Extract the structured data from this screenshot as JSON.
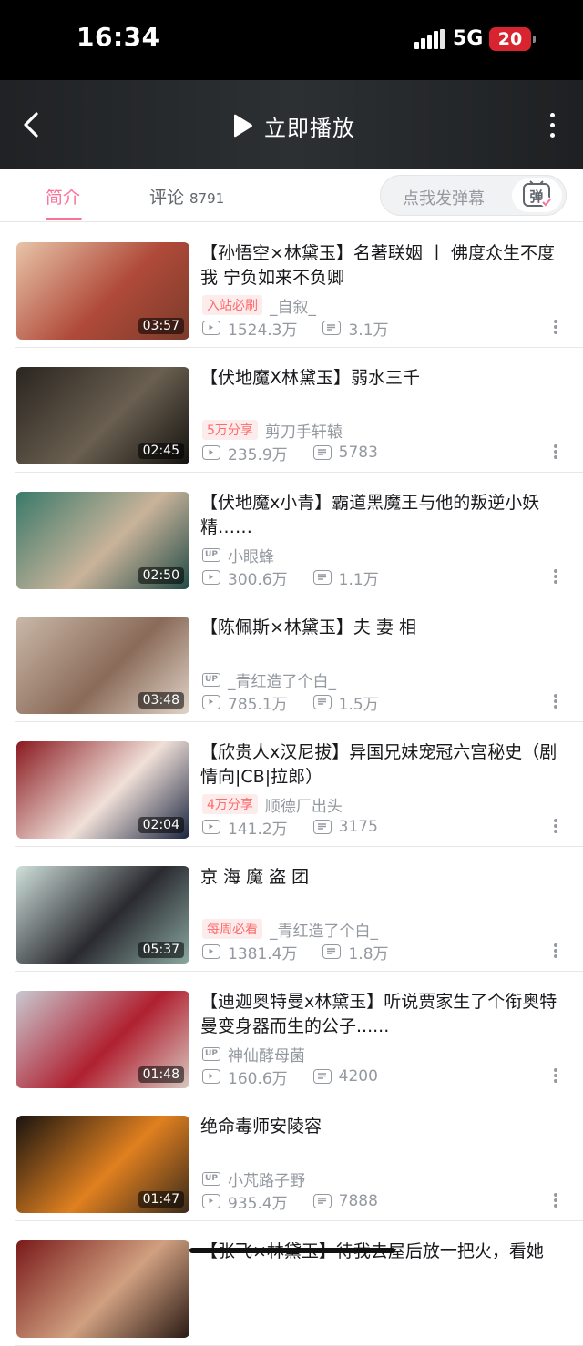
{
  "status_bar": {
    "time": "16:34",
    "network": "5G",
    "battery": "20"
  },
  "player_bar": {
    "play_label": "立即播放"
  },
  "tabs": {
    "intro": "简介",
    "comments": "评论",
    "comments_count": "8791",
    "danmaku_placeholder": "点我发弹幕"
  },
  "videos": [
    {
      "title": "【孙悟空×林黛玉】名著联姻 丨 佛度众生不度我  宁负如来不负卿",
      "badge": "入站必刷",
      "author": "_自叙_",
      "up_tag": false,
      "views": "1524.3万",
      "danmaku": "3.1万",
      "duration": "03:57",
      "thumb_colors": [
        "#e8c4a8",
        "#b04a3a",
        "#7a3b2a"
      ]
    },
    {
      "title": "【伏地魔X林黛玉】弱水三千",
      "badge": "5万分享",
      "author": "剪刀手轩辕",
      "up_tag": false,
      "views": "235.9万",
      "danmaku": "5783",
      "duration": "02:45",
      "thumb_colors": [
        "#2a2520",
        "#6a5f50",
        "#14120f"
      ]
    },
    {
      "title": "【伏地魔x小青】霸道黑魔王与他的叛逆小妖精……",
      "badge": "",
      "author": "小眼蜂",
      "up_tag": true,
      "views": "300.6万",
      "danmaku": "1.1万",
      "duration": "02:50",
      "thumb_colors": [
        "#3a7a6a",
        "#c9b39a",
        "#1f4a45"
      ]
    },
    {
      "title": "【陈佩斯×林黛玉】夫    妻    相",
      "badge": "",
      "author": "_青红造了个白_",
      "up_tag": true,
      "views": "785.1万",
      "danmaku": "1.5万",
      "duration": "03:48",
      "thumb_colors": [
        "#c9b8a8",
        "#8a6a58",
        "#e0d4c8"
      ]
    },
    {
      "title": "【欣贵人x汉尼拔】异国兄妹宠冠六宫秘史（剧情向|CB|拉郎）",
      "badge": "4万分享",
      "author": "顺德厂出头",
      "up_tag": false,
      "views": "141.2万",
      "danmaku": "3175",
      "duration": "02:04",
      "thumb_colors": [
        "#8a1a20",
        "#f0e0d8",
        "#1a2540"
      ]
    },
    {
      "title": "京 海 魔 盗 团",
      "badge": "每周必看",
      "author": "_青红造了个白_",
      "up_tag": false,
      "views": "1381.4万",
      "danmaku": "1.8万",
      "duration": "05:37",
      "thumb_colors": [
        "#cfe0da",
        "#2a2a30",
        "#8aa8a0"
      ]
    },
    {
      "title": "【迪迦奥特曼x林黛玉】听说贾家生了个衔奥特曼变身器而生的公子......",
      "badge": "",
      "author": "神仙酵母菌",
      "up_tag": true,
      "views": "160.6万",
      "danmaku": "4200",
      "duration": "01:48",
      "thumb_colors": [
        "#c8c8d0",
        "#b02030",
        "#d8c8c0"
      ]
    },
    {
      "title": "绝命毒师安陵容",
      "badge": "",
      "author": "小芃路子野",
      "up_tag": true,
      "views": "935.4万",
      "danmaku": "7888",
      "duration": "01:47",
      "thumb_colors": [
        "#1a1410",
        "#e08020",
        "#3a2a1a"
      ]
    },
    {
      "title": "【张飞×林黛玉】待我去屋后放一把火，看她",
      "badge": "",
      "author": "",
      "up_tag": false,
      "views": "",
      "danmaku": "",
      "duration": "",
      "thumb_colors": [
        "#7a1a1a",
        "#d0a080",
        "#2a1a14"
      ]
    }
  ]
}
